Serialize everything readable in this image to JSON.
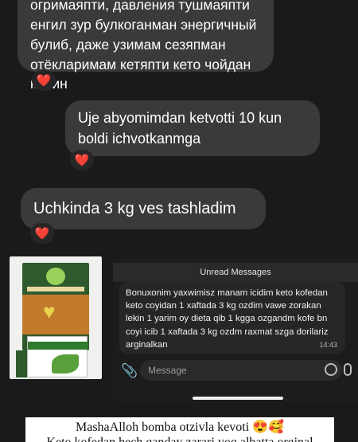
{
  "messages": {
    "top_text": "огримаяпти, давления тушмаяпти енгил зур булкоганман энергичный булиб, даже узимам сезяпман отёкларимам кетяпти кето чойдан кейин",
    "mid_text": "Uje abyomimdan ketvotti 10 kun boldi ichvotkanmga",
    "low_text": "Uchkinda 3 kg ves tashladim",
    "reaction": "❤️"
  },
  "embedded_chat": {
    "unread_label": "Unread Messages",
    "review_text": "Bonuxonim yaxwimisz manam icidim keto kofedan keto coyidan 1 xaftada 3 kg ozdim vawe zorakan lekin 1 yarim oy dieta qib 1 kgga ozgandm kofe bn coyi icib 1 xaftada 3 kg ozdm raxmat szga dorilariz arginalkan",
    "review_time": "14:43",
    "message_placeholder": "Message"
  },
  "banner": {
    "line1": "MashaAlloh bomba otzivla kevoti 😍🥰",
    "line2": "Keto kofedan hech qanday zarari yoq albatta orginal"
  },
  "icons": {
    "attach": "paperclip-icon",
    "sticker": "sticker-icon",
    "mic": "microphone-icon"
  }
}
